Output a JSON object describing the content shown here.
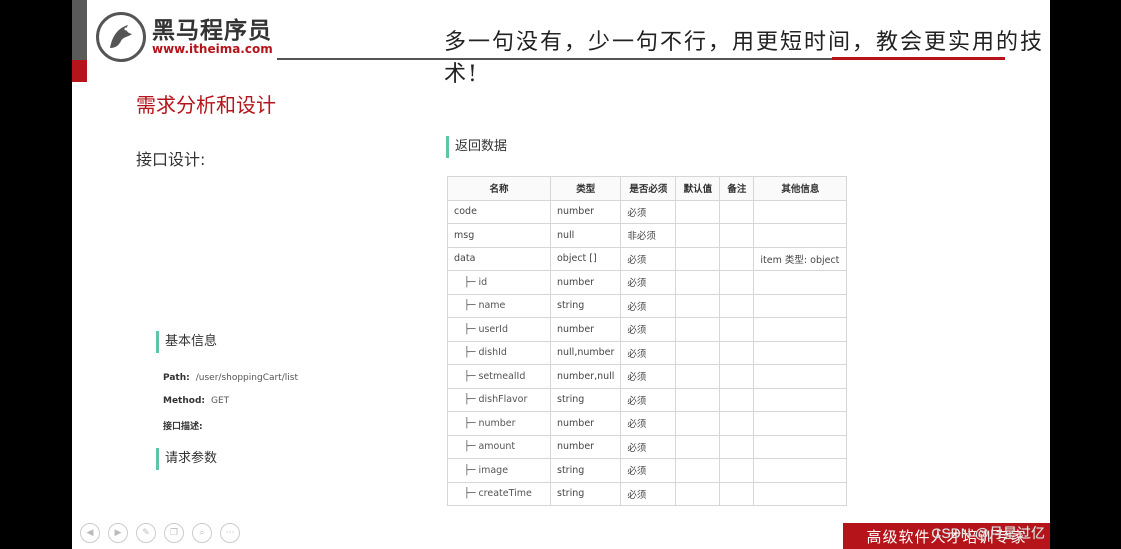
{
  "header": {
    "logo_cn": "黑马程序员",
    "logo_url": "www.itheima.com",
    "slogan": "多一句没有，少一句不行，用更短时间，教会更实用的技术!"
  },
  "title": "需求分析和设计",
  "subtitle": "接口设计:",
  "return_section": {
    "label": "返回数据"
  },
  "basic_section": {
    "label": "基本信息",
    "path_label": "Path:",
    "path_value": "/user/shoppingCart/list",
    "method_label": "Method:",
    "method_value": "GET",
    "desc_label": "接口描述:"
  },
  "request_section": {
    "label": "请求参数"
  },
  "table": {
    "headers": [
      "名称",
      "类型",
      "是否必须",
      "默认值",
      "备注",
      "其他信息"
    ],
    "rows": [
      {
        "name": "code",
        "type": "number",
        "required": "必须",
        "default": "",
        "note": "",
        "other": ""
      },
      {
        "name": "msg",
        "type": "null",
        "required": "非必须",
        "default": "",
        "note": "",
        "other": ""
      },
      {
        "name": "data",
        "type": "object []",
        "required": "必须",
        "default": "",
        "note": "",
        "other": "item 类型: object"
      },
      {
        "name": "├─ id",
        "type": "number",
        "required": "必须",
        "default": "",
        "note": "",
        "other": ""
      },
      {
        "name": "├─ name",
        "type": "string",
        "required": "必须",
        "default": "",
        "note": "",
        "other": ""
      },
      {
        "name": "├─ userId",
        "type": "number",
        "required": "必须",
        "default": "",
        "note": "",
        "other": ""
      },
      {
        "name": "├─ dishId",
        "type": "null,number",
        "required": "必须",
        "default": "",
        "note": "",
        "other": ""
      },
      {
        "name": "├─ setmealId",
        "type": "number,null",
        "required": "必须",
        "default": "",
        "note": "",
        "other": ""
      },
      {
        "name": "├─ dishFlavor",
        "type": "string",
        "required": "必须",
        "default": "",
        "note": "",
        "other": ""
      },
      {
        "name": "├─ number",
        "type": "number",
        "required": "必须",
        "default": "",
        "note": "",
        "other": ""
      },
      {
        "name": "├─ amount",
        "type": "number",
        "required": "必须",
        "default": "",
        "note": "",
        "other": ""
      },
      {
        "name": "├─ image",
        "type": "string",
        "required": "必须",
        "default": "",
        "note": "",
        "other": ""
      },
      {
        "name": "├─ createTime",
        "type": "string",
        "required": "必须",
        "default": "",
        "note": "",
        "other": ""
      }
    ]
  },
  "footer": {
    "banner": "高级软件人才培训专家",
    "watermark": "CSDN @月星过亿"
  },
  "toolbar": {
    "icons": [
      "prev-icon",
      "next-icon",
      "pen-icon",
      "copy-icon",
      "zoom-icon",
      "more-icon"
    ]
  },
  "colors": {
    "accent": "#b5141a",
    "section_bar": "#5fc4a8"
  }
}
